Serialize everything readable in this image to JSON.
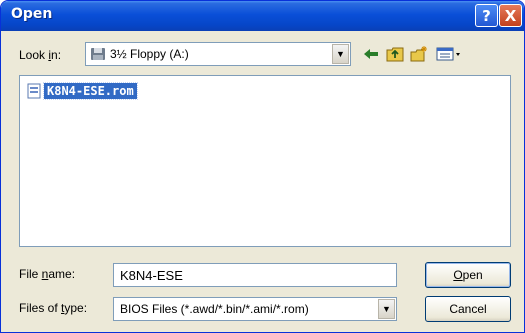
{
  "window": {
    "title": "Open",
    "help_label": "?",
    "close_label": "X"
  },
  "lookin": {
    "label_pre": "Look ",
    "label_key": "i",
    "label_post": "n:",
    "value": "3½ Floppy (A:)"
  },
  "toolbar": {
    "icons": [
      "back-arrow-icon",
      "up-folder-icon",
      "new-folder-icon",
      "view-menu-icon"
    ]
  },
  "files": [
    {
      "name": "K8N4-ESE.rom",
      "selected": true
    }
  ],
  "filename": {
    "label_pre": "File ",
    "label_key": "n",
    "label_post": "ame:",
    "value": "K8N4-ESE"
  },
  "filetype": {
    "label_pre": "Files of ",
    "label_key": "t",
    "label_post": "ype:",
    "value": "BIOS Files (*.awd/*.bin/*.ami/*.rom)"
  },
  "buttons": {
    "open_key": "O",
    "open_rest": "pen",
    "cancel": "Cancel"
  },
  "colors": {
    "title_bar": "#0a4fd8",
    "selection": "#316ac5",
    "dialog_bg": "#ece9d8"
  }
}
